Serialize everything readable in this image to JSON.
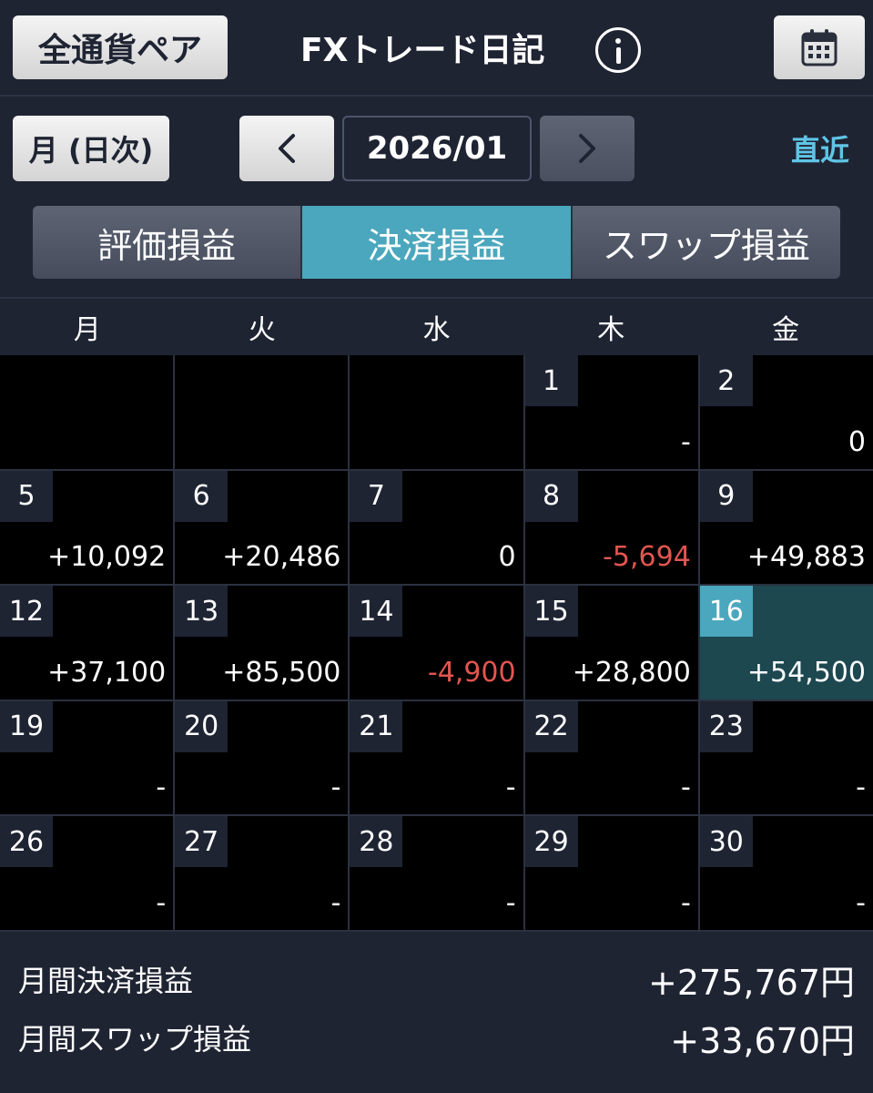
{
  "header": {
    "pair_label": "全通貨ペア",
    "title": "FXトレード日記",
    "info_icon": "info-icon",
    "calendar_icon": "calendar-icon"
  },
  "period": {
    "mode_label": "月 (日次)",
    "month": "2026/01",
    "recent_label": "直近"
  },
  "tabs": [
    {
      "label": "評価損益",
      "active": false
    },
    {
      "label": "決済損益",
      "active": true
    },
    {
      "label": "スワップ損益",
      "active": false
    }
  ],
  "weekdays": [
    "月",
    "火",
    "水",
    "木",
    "金"
  ],
  "calendar": [
    {
      "day": "",
      "value": "",
      "empty": true
    },
    {
      "day": "",
      "value": "",
      "empty": true
    },
    {
      "day": "",
      "value": "",
      "empty": true
    },
    {
      "day": "1",
      "value": "-"
    },
    {
      "day": "2",
      "value": "0"
    },
    {
      "day": "5",
      "value": "+10,092"
    },
    {
      "day": "6",
      "value": "+20,486"
    },
    {
      "day": "7",
      "value": "0"
    },
    {
      "day": "8",
      "value": "-5,694",
      "negative": true
    },
    {
      "day": "9",
      "value": "+49,883"
    },
    {
      "day": "12",
      "value": "+37,100"
    },
    {
      "day": "13",
      "value": "+85,500"
    },
    {
      "day": "14",
      "value": "-4,900",
      "negative": true
    },
    {
      "day": "15",
      "value": "+28,800"
    },
    {
      "day": "16",
      "value": "+54,500",
      "today": true
    },
    {
      "day": "19",
      "value": "-"
    },
    {
      "day": "20",
      "value": "-"
    },
    {
      "day": "21",
      "value": "-"
    },
    {
      "day": "22",
      "value": "-"
    },
    {
      "day": "23",
      "value": "-"
    },
    {
      "day": "26",
      "value": "-"
    },
    {
      "day": "27",
      "value": "-"
    },
    {
      "day": "28",
      "value": "-"
    },
    {
      "day": "29",
      "value": "-"
    },
    {
      "day": "30",
      "value": "-"
    }
  ],
  "summary": {
    "settled_label": "月間決済損益",
    "settled_value": "+275,767円",
    "swap_label": "月間スワップ損益",
    "swap_value": "+33,670円"
  },
  "colors": {
    "background": "#1f2433",
    "accent": "#4ba7bd",
    "negative": "#e2554f",
    "link": "#5fc5e6"
  }
}
